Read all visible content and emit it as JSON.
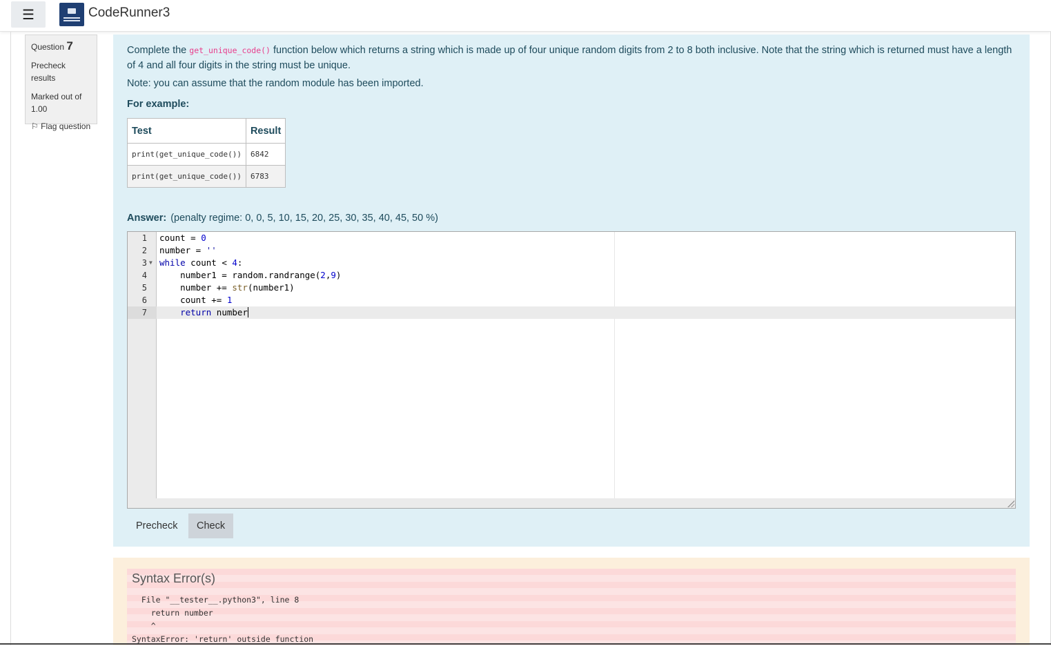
{
  "navbar": {
    "menu_icon": "☰",
    "site_name": "CodeRunner3"
  },
  "question_info": {
    "question_label": "Question",
    "question_number": "7",
    "state": "Precheck results",
    "marked_out_of": "Marked out of 1.00",
    "flag_label": "Flag question"
  },
  "question": {
    "text_before": "Complete the ",
    "function_name": "get_unique_code()",
    "text_after": " function below which returns a string which is made up of four unique random digits from 2 to 8 both inclusive. Note that the string which is returned must have a length of 4 and all four digits in the string must be unique.",
    "note": "Note: you can assume that the random module has been imported.",
    "for_example": "For example:",
    "table": {
      "headers": [
        "Test",
        "Result"
      ],
      "rows": [
        [
          "print(get_unique_code())",
          "6842"
        ],
        [
          "print(get_unique_code())",
          "6783"
        ]
      ]
    }
  },
  "answer": {
    "label": "Answer:",
    "penalty": "(penalty regime: 0, 0, 5, 10, 15, 20, 25, 30, 35, 40, 45, 50 %)",
    "line_numbers": [
      "1",
      "2",
      "3",
      "4",
      "5",
      "6",
      "7"
    ]
  },
  "buttons": {
    "precheck": "Precheck",
    "check": "Check"
  },
  "outcome": {
    "title": "Syntax Error(s)",
    "lines": [
      "  File \"__tester__.python3\", line 8",
      "    return number",
      "    ^",
      "SyntaxError: 'return' outside function"
    ]
  }
}
